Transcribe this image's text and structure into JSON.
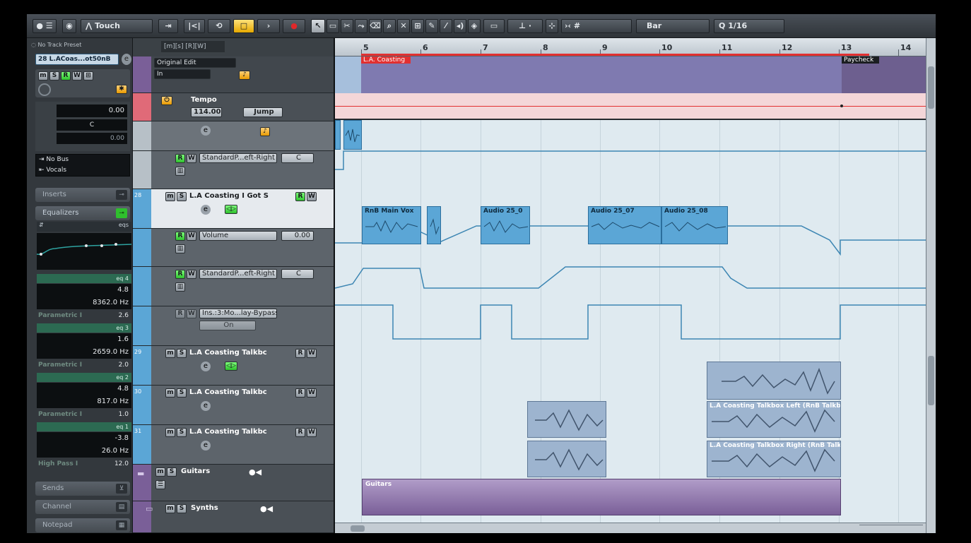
{
  "toolbar": {
    "automation_mode": "Touch",
    "snap_type": "Bar",
    "quantize": "1/16"
  },
  "inspector": {
    "preset": "No Track Preset",
    "track_name": "L.ACoas...ot50nB",
    "track_number": "28",
    "volume": "0.00",
    "pan": "C",
    "send_level": "0.00",
    "input_routing": "No Bus",
    "output_routing": "Vocals",
    "sections": {
      "inserts": "Inserts",
      "equalizers": "Equalizers",
      "sends": "Sends",
      "channel": "Channel",
      "notepad": "Notepad"
    },
    "eq_tag": "eqs",
    "eq_bands": [
      {
        "label": "eq 4",
        "gain": "4.8",
        "freq": "8362.0 Hz",
        "type": "Parametric I",
        "q": "2.6"
      },
      {
        "label": "eq 3",
        "gain": "1.6",
        "freq": "2659.0 Hz",
        "type": "Parametric I",
        "q": "2.0"
      },
      {
        "label": "eq 2",
        "gain": "4.8",
        "freq": "817.0 Hz",
        "type": "Parametric I",
        "q": "1.0"
      },
      {
        "label": "eq 1",
        "gain": "-3.8",
        "freq": "26.0 Hz",
        "type": "High Pass I",
        "q": "12.0"
      }
    ]
  },
  "tracklist": {
    "marker": {
      "mode": "Original Edit",
      "sub": "In"
    },
    "tempo": {
      "name": "Tempo",
      "value": "114.000",
      "mode": "Jump"
    },
    "rows": {
      "pan_top": {
        "param": "StandardP...eft-Right",
        "value": "C"
      },
      "track28": {
        "num": "28",
        "name": "L.A Coasting I Got S"
      },
      "volume": {
        "param": "Volume",
        "value": "0.00"
      },
      "pan": {
        "param": "StandardP...eft-Right",
        "value": "C"
      },
      "bypass": {
        "param": "Ins.:3:Mo...lay-Bypass",
        "value": "On"
      },
      "track29": {
        "num": "29",
        "name": "L.A Coasting Talkbc"
      },
      "track30": {
        "num": "30",
        "name": "L.A Coasting Talkbc"
      },
      "track31": {
        "num": "31",
        "name": "L.A Coasting Talkbc"
      },
      "guitars": {
        "name": "Guitars"
      },
      "synths": {
        "name": "Synths"
      }
    }
  },
  "ruler": {
    "bars": [
      "5",
      "6",
      "7",
      "8",
      "9",
      "10",
      "11",
      "12",
      "13",
      "14"
    ]
  },
  "arrange": {
    "markers": {
      "coasting": "L.A. Coasting",
      "paycheck": "Paycheck"
    },
    "clips": {
      "rnb_main_vox": "RnB Main Vox",
      "audio_25_0": "Audio 25_0",
      "audio_25_07": "Audio 25_07",
      "audio_25_08": "Audio 25_08",
      "talkbox_left": "L.A Coasting Talkbox Left (RnB Talkb",
      "talkbox_right": "L.A Coasting Talkbox Right (RnB Talkb",
      "guitars": "Guitars"
    }
  },
  "colors": {
    "accent": "#2fc02d",
    "marker_red": "#e23030",
    "folder_purple": "#7a5f98",
    "audio_blue": "#5ba6d6"
  }
}
